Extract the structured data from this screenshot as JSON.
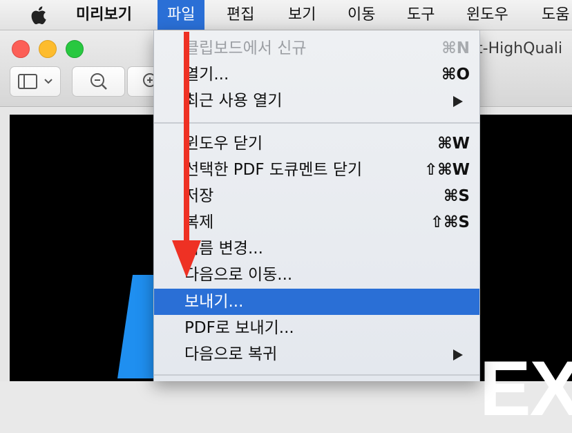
{
  "menubar": {
    "app_name": "미리보기",
    "items": [
      "파일",
      "편집",
      "보기",
      "이동",
      "도구",
      "윈도우",
      "도움"
    ]
  },
  "window": {
    "title_fragment": "t-HighQuali"
  },
  "document": {
    "visible_text": "EXI"
  },
  "file_menu": {
    "items": [
      {
        "label": "클립보드에서 신규",
        "shortcut": "⌘N",
        "enabled": false
      },
      {
        "label": "열기...",
        "shortcut": "⌘O",
        "enabled": true
      },
      {
        "label": "최근 사용 열기",
        "shortcut": "",
        "submenu": true,
        "enabled": true
      },
      {
        "label": "윈도우 닫기",
        "shortcut": "⌘W",
        "enabled": true
      },
      {
        "label": "선택한 PDF 도큐멘트 닫기",
        "shortcut": "⇧⌘W",
        "enabled": true
      },
      {
        "label": "저장",
        "shortcut": "⌘S",
        "enabled": true
      },
      {
        "label": "복제",
        "shortcut": "⇧⌘S",
        "enabled": true
      },
      {
        "label": "이름 변경...",
        "shortcut": "",
        "enabled": true
      },
      {
        "label": "다음으로 이동...",
        "shortcut": "",
        "enabled": true
      },
      {
        "label": "보내기...",
        "shortcut": "",
        "enabled": true,
        "highlighted": true
      },
      {
        "label": "PDF로 보내기...",
        "shortcut": "",
        "enabled": true
      },
      {
        "label": "다음으로 복귀",
        "shortcut": "",
        "submenu": true,
        "enabled": true
      }
    ]
  },
  "colors": {
    "highlight": "#2a6fd6",
    "annotation_arrow": "#ee3124"
  }
}
